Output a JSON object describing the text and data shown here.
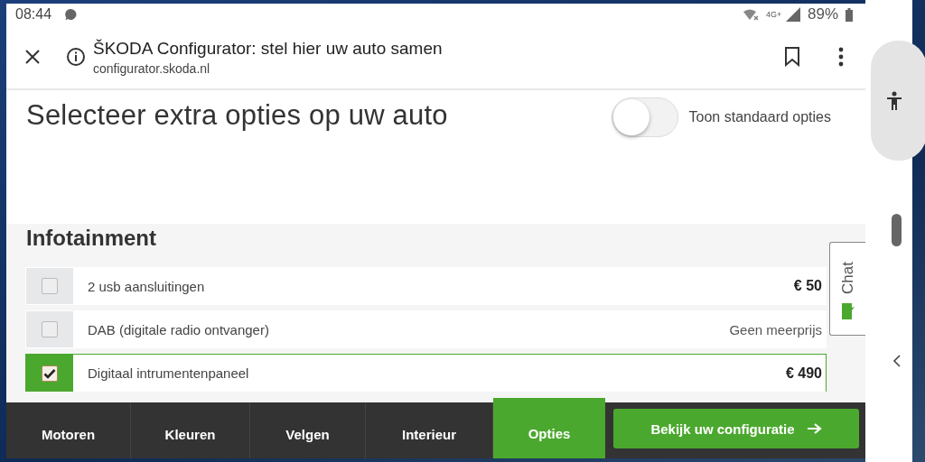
{
  "status_bar": {
    "time": "08:44",
    "network": "4G+",
    "battery": "89%"
  },
  "browser": {
    "title": "ŠKODA Configurator: stel hier uw auto samen",
    "url": "configurator.skoda.nl"
  },
  "page": {
    "heading": "Selecteer extra opties op uw auto",
    "toggle": {
      "label": "Toon standaard opties",
      "on": false
    }
  },
  "section": {
    "title": "Infotainment",
    "options": [
      {
        "label": "2 usb aansluitingen",
        "price": "€ 50",
        "checked": false,
        "kind": "amount"
      },
      {
        "label": "DAB (digitale radio ontvanger)",
        "price": "Geen meerprijs",
        "checked": false,
        "kind": "note"
      },
      {
        "label": "Digitaal intrumentenpaneel",
        "price": "€ 490",
        "checked": true,
        "kind": "amount"
      }
    ]
  },
  "chat_tab": {
    "label": "Chat"
  },
  "nav_tabs": [
    {
      "label": "Motoren",
      "selected": false
    },
    {
      "label": "Kleuren",
      "selected": false
    },
    {
      "label": "Velgen",
      "selected": false
    },
    {
      "label": "Interieur",
      "selected": false
    },
    {
      "label": "Opties",
      "selected": true
    }
  ],
  "cta_button": {
    "label": "Bekijk uw configuratie"
  }
}
